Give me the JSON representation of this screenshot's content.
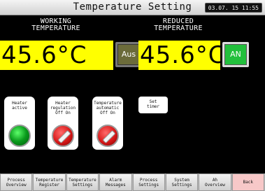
{
  "title": "Temperature Setting",
  "clock": "03.07. 15 11:55",
  "working": {
    "heading_line1": "WORKING",
    "heading_line2": "TEMPERATURE",
    "value": "45.6°C",
    "button_label": "Aus"
  },
  "reduced": {
    "heading_line1": "REDUCED",
    "heading_line2": "TEMPERATURE",
    "value": "45.6°C",
    "button_label": "AN"
  },
  "panels": [
    {
      "label": "Heater\nactive",
      "lamp": "green"
    },
    {
      "label": "Heater\nregulation\nOff  On",
      "lamp": "red"
    },
    {
      "label": "Temperature\nautomatic\nOff  On",
      "lamp": "red"
    }
  ],
  "set_timer_label": "Set\ntimer",
  "footer": [
    {
      "label": "Process\nOverview"
    },
    {
      "label": "Temperature\nRegister"
    },
    {
      "label": "Temperature\nSettings"
    },
    {
      "label": "Alarm\nMessages"
    },
    {
      "label": "Process\nSettings"
    },
    {
      "label": "System\nSettings"
    },
    {
      "label": "Ah\nOverview"
    },
    {
      "label": "Back"
    }
  ],
  "colors": {
    "background": "#000000",
    "value_field": "#ffff00",
    "on_button": "#22c03c",
    "off_button": "#6b6b3a",
    "back_button": "#f7c8c8"
  }
}
